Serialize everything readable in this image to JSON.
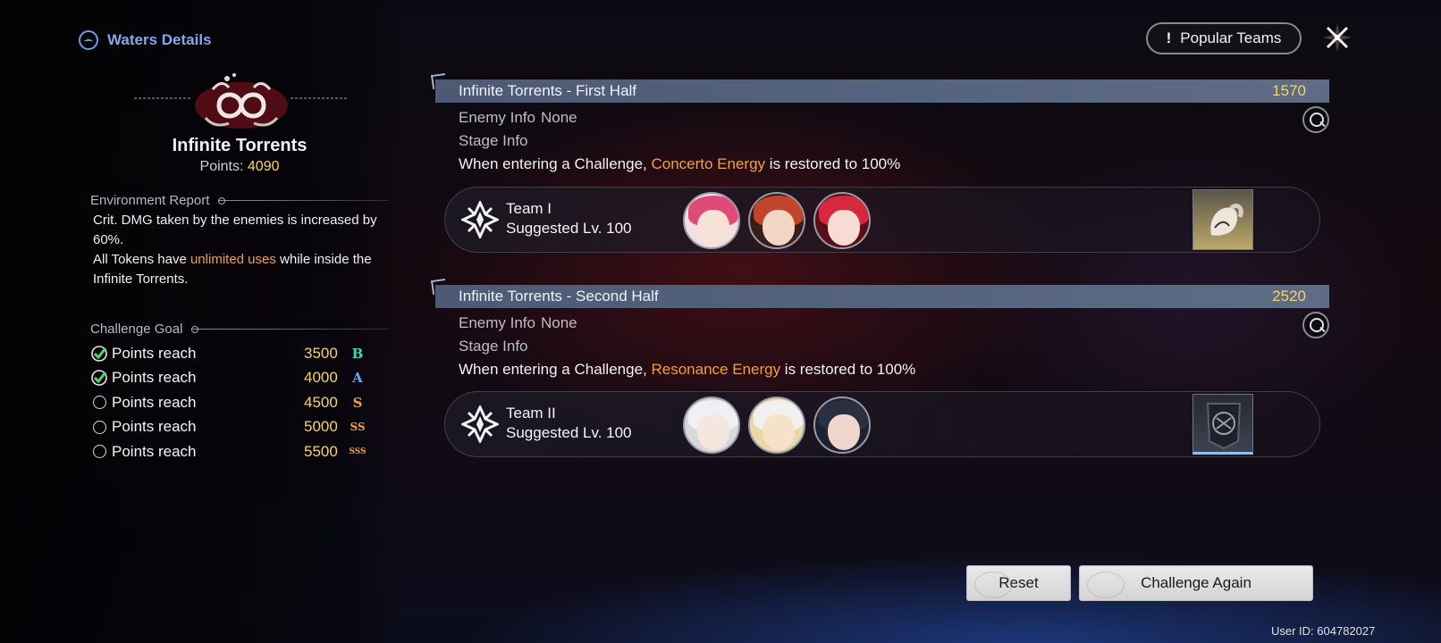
{
  "header": {
    "title": "Waters Details"
  },
  "tower": {
    "name": "Infinite Torrents",
    "points_label": "Points:",
    "points_value": "4090"
  },
  "environment": {
    "heading": "Environment Report",
    "line1": "Crit. DMG taken by the enemies is increased by 60%.",
    "line2_pre": "All Tokens have ",
    "line2_hl": "unlimited uses",
    "line2_post": " while inside the Infinite Torrents."
  },
  "challenge_goal": {
    "heading": "Challenge Goal",
    "goals": [
      {
        "label": "Points reach",
        "value": "3500",
        "rank": "B",
        "rank_color": "#3fd8b0",
        "done": true
      },
      {
        "label": "Points reach",
        "value": "4000",
        "rank": "A",
        "rank_color": "#6aa8f0",
        "done": true
      },
      {
        "label": "Points reach",
        "value": "4500",
        "rank": "S",
        "rank_color": "#f2a03c",
        "done": false
      },
      {
        "label": "Points reach",
        "value": "5000",
        "rank": "SS",
        "rank_color": "#f2a03c",
        "done": false
      },
      {
        "label": "Points reach",
        "value": "5500",
        "rank": "SSS",
        "rank_color": "#f2a03c",
        "done": false
      }
    ]
  },
  "top": {
    "popular_label": "Popular Teams",
    "popular_icon": "!"
  },
  "halves": [
    {
      "title": "Infinite Torrents - First Half",
      "score": "1570",
      "enemy_label": "Enemy Info",
      "enemy_value": "None",
      "stage_label": "Stage Info",
      "desc_pre": "When entering a Challenge, ",
      "desc_hl": "Concerto Energy",
      "desc_post": " is restored to 100%",
      "team_name": "Team I",
      "suggested": "Suggested Lv. 100"
    },
    {
      "title": "Infinite Torrents - Second Half",
      "score": "2520",
      "enemy_label": "Enemy Info",
      "enemy_value": "None",
      "stage_label": "Stage Info",
      "desc_pre": "When entering a Challenge, ",
      "desc_hl": "Resonance Energy",
      "desc_post": " is restored to 100%",
      "team_name": "Team II",
      "suggested": "Suggested Lv. 100"
    }
  ],
  "buttons": {
    "reset": "Reset",
    "challenge_again": "Challenge Again"
  },
  "footer": {
    "user_id": "User ID: 604782027"
  },
  "colors": {
    "accent_gold": "#f3d36b",
    "highlight_orange": "#f2a03c",
    "header_blue": "#7fa9ec",
    "bar_slate": "#56657f"
  }
}
